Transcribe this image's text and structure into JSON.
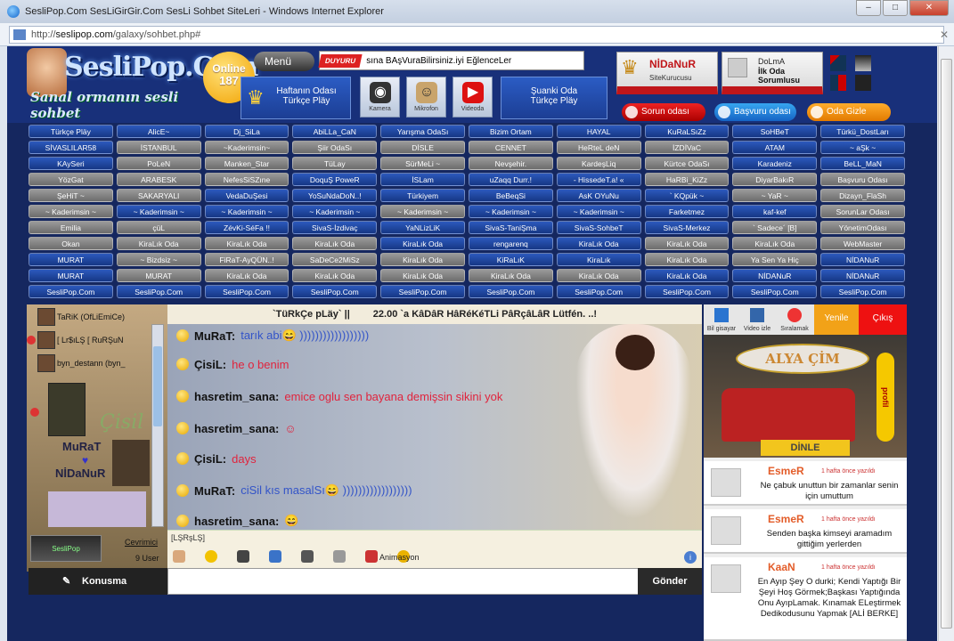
{
  "window": {
    "title": "SesliPop.Com SesLiGirGir.Com SesLi Sohbet SiteLeri - Windows Internet Explorer",
    "url_prefix": "http://",
    "url_domain": "seslipop.com",
    "url_path": "/galaxy/sohbet.php#"
  },
  "header": {
    "logo_title": "SesliPop.Com",
    "logo_sub": "Sanal ormanın sesli sohbet",
    "online_label": "Online",
    "online_count": "187",
    "menu_label": "Menü",
    "duyuru_tag": "DUYURU",
    "duyuru_text": "sına BAşVuraBilirsiniz.iyi EğlenceLer",
    "haftanin_label": "Haftanın Odası",
    "haftanin_room": "Türkçe Pläy",
    "kamera": "Kamera",
    "mikrofon": "Mikrofon",
    "videoda": "Videoda",
    "suanki_label": "Şuanki Oda",
    "suanki_room": "Türkçe Pläy",
    "founder_name": "NİDaNuR",
    "founder_role": "SiteKurucusu",
    "dolma_name": "DoLmA",
    "dolma_role": "İlk Oda Sorumlusu",
    "sorun": "Sorun odası",
    "basvuru": "Başvuru odası",
    "odagizle": "Oda Gizle"
  },
  "rooms": [
    [
      "Türkçe Pläy",
      "b"
    ],
    [
      "AlicE~",
      "b"
    ],
    [
      "Dj_SiLa",
      "b"
    ],
    [
      "AbiLLa_CaN",
      "b"
    ],
    [
      "Yarışma OdaSı",
      "b"
    ],
    [
      "Bizim Ortam",
      "b"
    ],
    [
      "HAYAL",
      "b"
    ],
    [
      "KuRaLSıZz",
      "b"
    ],
    [
      "SoHBeT",
      "b"
    ],
    [
      "Türkü_DostLarı",
      "b"
    ],
    [
      "SİVASLILAR58",
      "b"
    ],
    [
      "İSTANBUL",
      "g"
    ],
    [
      "~Kaderimsin~",
      "g"
    ],
    [
      "Şiir OdaSı",
      "g"
    ],
    [
      "DİSLE",
      "g"
    ],
    [
      "CENNET",
      "g"
    ],
    [
      "HeRteL deN",
      "g"
    ],
    [
      "İZDİVaC",
      "g"
    ],
    [
      "ATAM",
      "b"
    ],
    [
      "~ aŞk ~",
      "b"
    ],
    [
      "KAySeri",
      "b"
    ],
    [
      "PoLeN",
      "g"
    ],
    [
      "Manken_Star",
      "g"
    ],
    [
      "TüLay",
      "g"
    ],
    [
      "SürMeLi ~",
      "g"
    ],
    [
      "Nevşehir.",
      "g"
    ],
    [
      "KardeşLiq",
      "g"
    ],
    [
      "Kürtce OdaSı",
      "g"
    ],
    [
      "Karadeniz",
      "b"
    ],
    [
      "BeLL_MaN",
      "b"
    ],
    [
      "YözGat",
      "g"
    ],
    [
      "ARABESK",
      "g"
    ],
    [
      "NefesSiSZıne",
      "g"
    ],
    [
      "DoquŞ PoweR",
      "b"
    ],
    [
      "İSLam",
      "b"
    ],
    [
      "uZaqq Durr.!",
      "b"
    ],
    [
      "- HissedeT.a! «",
      "b"
    ],
    [
      "HaRBi_KiZz",
      "g"
    ],
    [
      "DiyarBakıR",
      "g"
    ],
    [
      "Başvuru Odası",
      "g"
    ],
    [
      "ŞeHiT ~",
      "g"
    ],
    [
      "SAKARYALI",
      "g"
    ],
    [
      "VedaDuŞesi",
      "b"
    ],
    [
      "YoSuNdaDoN..!",
      "b"
    ],
    [
      "Türkiyem",
      "b"
    ],
    [
      "BeBeqSi",
      "b"
    ],
    [
      "AsK OYuNu",
      "b"
    ],
    [
      "` KQpük ~",
      "b"
    ],
    [
      "~ YaR ~",
      "g"
    ],
    [
      "Dizayn_FlaSh",
      "g"
    ],
    [
      "~ Kaderimsin ~",
      "g"
    ],
    [
      "~ Kaderimsin ~",
      "b"
    ],
    [
      "~ Kaderimsin ~",
      "b"
    ],
    [
      "~ Kaderimsin ~",
      "b"
    ],
    [
      "~ Kaderimsin ~",
      "g"
    ],
    [
      "~ Kaderimsin ~",
      "b"
    ],
    [
      "~ Kaderimsin ~",
      "b"
    ],
    [
      "Farketmez",
      "b"
    ],
    [
      "kaf-kef",
      "b"
    ],
    [
      "SorunLar Odası",
      "g"
    ],
    [
      "Emilia",
      "g"
    ],
    [
      "çüL",
      "g"
    ],
    [
      "ZévKi-SéFa !!",
      "b"
    ],
    [
      "SivaS-İzdivaç",
      "b"
    ],
    [
      "YaNLizLiK",
      "b"
    ],
    [
      "SivaS-TaniŞma",
      "b"
    ],
    [
      "SivaS-SohbeT",
      "b"
    ],
    [
      "SivaS-Merkez",
      "b"
    ],
    [
      "` Sadece´ [B]",
      "g"
    ],
    [
      "YönetimOdası",
      "g"
    ],
    [
      "Okan",
      "g"
    ],
    [
      "KiraLık Oda",
      "g"
    ],
    [
      "KiraLık Oda",
      "g"
    ],
    [
      "KiraLık Oda",
      "g"
    ],
    [
      "KiraLık Oda",
      "b"
    ],
    [
      "rengarenq",
      "b"
    ],
    [
      "KiraLık Oda",
      "b"
    ],
    [
      "KiraLık Oda",
      "g"
    ],
    [
      "KiraLık Oda",
      "g"
    ],
    [
      "WebMaster",
      "g"
    ],
    [
      "MURAT",
      "b"
    ],
    [
      "~ Bizdsiz ~",
      "g"
    ],
    [
      "FiRaT-AyQÜN..!",
      "g"
    ],
    [
      "SaDeCe2MiSz",
      "g"
    ],
    [
      "KiraLık Oda",
      "g"
    ],
    [
      "KiRaLıK",
      "b"
    ],
    [
      "KiraLık",
      "b"
    ],
    [
      "KiraLık Oda",
      "g"
    ],
    [
      "Ya Sen Ya Hiç",
      "g"
    ],
    [
      "NİDANuR",
      "b"
    ],
    [
      "MURAT",
      "b"
    ],
    [
      "MURAT",
      "g"
    ],
    [
      "KiraLık Oda",
      "g"
    ],
    [
      "KiraLık Oda",
      "g"
    ],
    [
      "KiraLık Oda",
      "g"
    ],
    [
      "KiraLık Oda",
      "g"
    ],
    [
      "KiraLık Oda",
      "g"
    ],
    [
      "KiraLık Oda",
      "b"
    ],
    [
      "NİDANuR",
      "b"
    ],
    [
      "NİDANuR",
      "b"
    ],
    [
      "SesliPop.Com",
      "b"
    ],
    [
      "SesliPop.Com",
      "b"
    ],
    [
      "SesliPop.Com",
      "b"
    ],
    [
      "SesliPop.Com",
      "b"
    ],
    [
      "SesliPop.Com",
      "b"
    ],
    [
      "SesliPop.Com",
      "b"
    ],
    [
      "SesliPop.Com",
      "b"
    ],
    [
      "SesliPop.Com",
      "b"
    ],
    [
      "SesliPop.Com",
      "b"
    ],
    [
      "SesliPop.Com",
      "b"
    ]
  ],
  "users": [
    {
      "name": "TaRiK (OfLiEmiCe)"
    },
    {
      "name": "[ Lr$ıLŞ [ RuRŞuN"
    },
    {
      "name": "byn_destann (byn_"
    }
  ],
  "users_side_text": {
    "murat": "MuRaT",
    "nidanur": "NİDaNuR",
    "cisil": "Çisil"
  },
  "chat": {
    "room_title": "`TüRkÇe pLäy`  ||",
    "marquee": "22.00 `a KâDâR HâRéKéTLi PâRçâLâR Lütfén. ..!",
    "messages": [
      {
        "name": "MuRaT:",
        "text": "tarık abi😄 ))))))))))))))))))",
        "color": "blue"
      },
      {
        "name": "ÇisiL:",
        "text": "he o benim",
        "color": "red"
      },
      {
        "name": "hasretim_sana:",
        "text": "emice oglu sen bayana demişsin sikini yok",
        "color": "red"
      },
      {
        "name": "hasretim_sana:",
        "text": "☺",
        "color": "red"
      },
      {
        "name": "ÇisiL:",
        "text": "days",
        "color": "red"
      },
      {
        "name": "MuRaT:",
        "text": "ciSil kıs masalSı😄 ))))))))))))))))))",
        "color": "blue"
      },
      {
        "name": "hasretim_sana:",
        "text": "😄",
        "color": "red"
      }
    ],
    "input_label": "[LŞRşLŞ]",
    "animasyon": "Animasyon",
    "konusma": "Konusma",
    "gonder": "Gönder"
  },
  "online_panel": {
    "banner": "SesliPop",
    "link": "Cevrimici",
    "count": "9 User"
  },
  "right": {
    "tools": [
      "Bil gisayar",
      "Video izle",
      "Sıralamak",
      "Yenile",
      "Çıkış"
    ],
    "sign": "ALYA ÇİM",
    "profil": "profil",
    "dinle": "DİNLE",
    "notes": [
      {
        "name": "EsmeR",
        "time": "1 hafta önce yazıldı",
        "text": "Ne çabuk unuttun bir zamanlar senin için umuttum"
      },
      {
        "name": "EsmeR",
        "time": "1 hafta önce yazıldı",
        "text": "Senden başka kimseyi aramadım gittiğim yerlerden"
      },
      {
        "name": "KaaN",
        "time": "1 hafta önce yazıldı",
        "text": "En Ayıp Şey O durki; Kendi Yaptığı Bir Şeyi Hoş Görmek;Başkası Yaptığında Onu AyıpLamak. Kınamak ELeştirmek Dedikodusunu Yapmak [ALİ BERKE]"
      }
    ]
  },
  "colors": {
    "page_bg": "#15275f",
    "room_blue": "#1c3e94",
    "room_gray": "#6c6c6c",
    "msg_red": "#e0243d",
    "msg_blue": "#3354c8"
  }
}
